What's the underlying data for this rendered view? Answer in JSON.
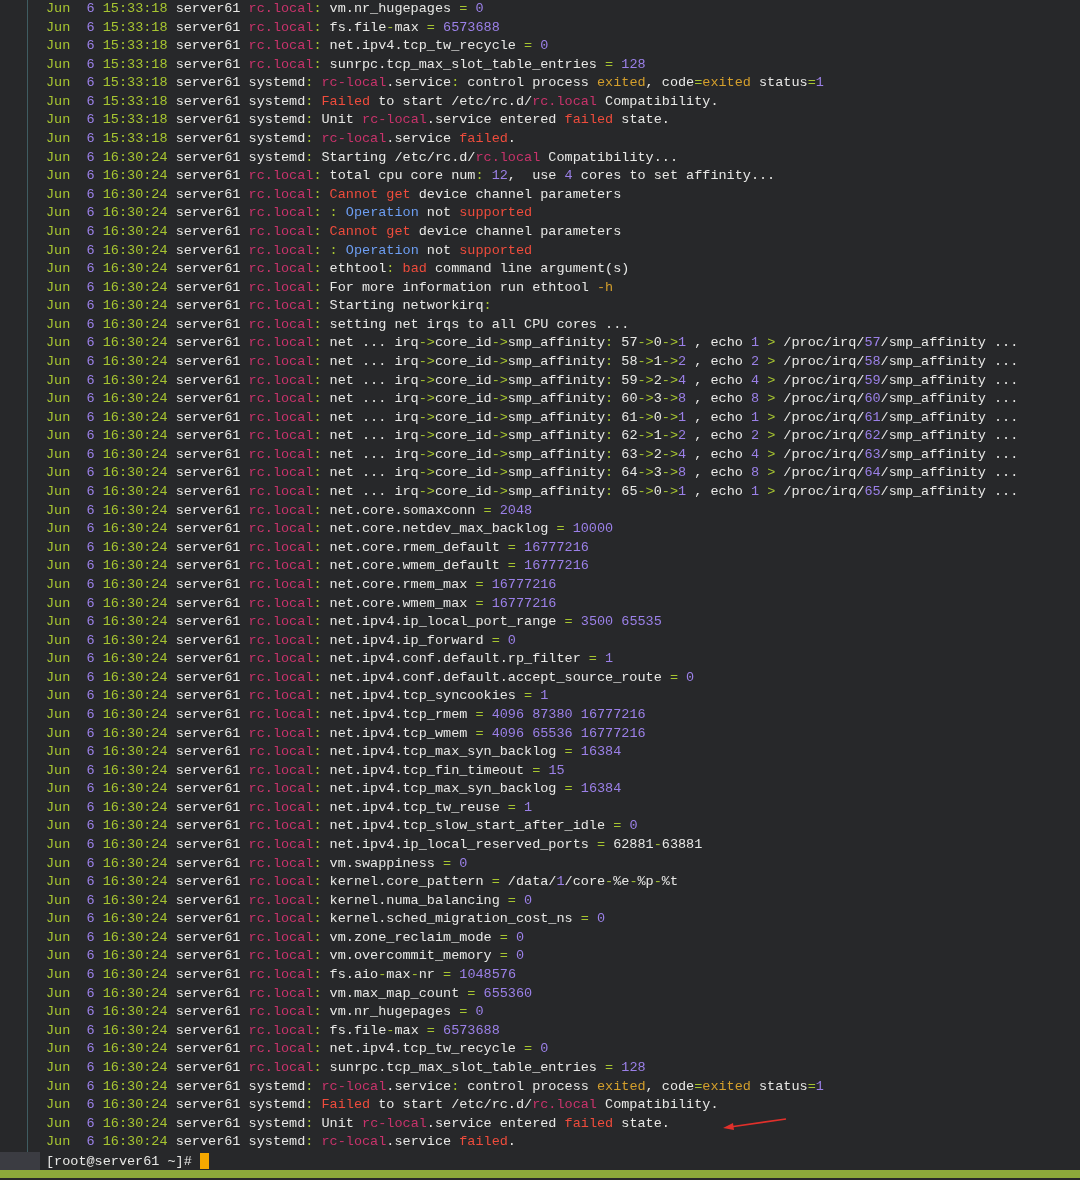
{
  "log_lines": [
    {
      "month": "Jun",
      "day": "6",
      "time": "15:33:18",
      "host": "server61",
      "process": "rc.local",
      "kind": "script",
      "message": "vm.nr_hugepages = 0"
    },
    {
      "month": "Jun",
      "day": "6",
      "time": "15:33:18",
      "host": "server61",
      "process": "rc.local",
      "kind": "script",
      "message": "fs.file-max = 6573688"
    },
    {
      "month": "Jun",
      "day": "6",
      "time": "15:33:18",
      "host": "server61",
      "process": "rc.local",
      "kind": "script",
      "message": "net.ipv4.tcp_tw_recycle = 0"
    },
    {
      "month": "Jun",
      "day": "6",
      "time": "15:33:18",
      "host": "server61",
      "process": "rc.local",
      "kind": "script",
      "message": "sunrpc.tcp_max_slot_table_entries = 128"
    },
    {
      "month": "Jun",
      "day": "6",
      "time": "15:33:18",
      "host": "server61",
      "process": "systemd",
      "kind": "daemon",
      "message": [
        {
          "text": "rc-local",
          "kind": "process"
        },
        ".service: control process ",
        {
          "text": "exited",
          "kind": "warning"
        },
        ", code=",
        {
          "text": "exited",
          "kind": "warning"
        },
        " status=1"
      ]
    },
    {
      "month": "Jun",
      "day": "6",
      "time": "15:33:18",
      "host": "server61",
      "process": "systemd",
      "kind": "daemon",
      "message": [
        {
          "text": "Failed",
          "kind": "error"
        },
        " to start /etc/rc.d/",
        {
          "text": "rc.local",
          "kind": "process"
        },
        " Compatibility."
      ]
    },
    {
      "month": "Jun",
      "day": "6",
      "time": "15:33:18",
      "host": "server61",
      "process": "systemd",
      "kind": "daemon",
      "message": [
        "Unit ",
        {
          "text": "rc-local",
          "kind": "process"
        },
        ".service entered ",
        {
          "text": "failed",
          "kind": "error"
        },
        " state."
      ]
    },
    {
      "month": "Jun",
      "day": "6",
      "time": "15:33:18",
      "host": "server61",
      "process": "systemd",
      "kind": "daemon",
      "message": [
        {
          "text": "rc-local",
          "kind": "process"
        },
        ".service ",
        {
          "text": "failed",
          "kind": "error"
        },
        "."
      ]
    },
    {
      "month": "Jun",
      "day": "6",
      "time": "16:30:24",
      "host": "server61",
      "process": "systemd",
      "kind": "daemon",
      "message": [
        "Starting /etc/rc.d/",
        {
          "text": "rc.local",
          "kind": "process"
        },
        " Compatibility..."
      ]
    },
    {
      "month": "Jun",
      "day": "6",
      "time": "16:30:24",
      "host": "server61",
      "process": "rc.local",
      "kind": "script",
      "message": "total cpu core num: 12,  use 4 cores to set affinity..."
    },
    {
      "month": "Jun",
      "day": "6",
      "time": "16:30:24",
      "host": "server61",
      "process": "rc.local",
      "kind": "script",
      "message": [
        {
          "text": "Cannot get",
          "kind": "error"
        },
        " device channel parameters"
      ]
    },
    {
      "month": "Jun",
      "day": "6",
      "time": "16:30:24",
      "host": "server61",
      "process": "rc.local",
      "kind": "script",
      "message": [
        ": ",
        {
          "text": "Operation",
          "kind": "info"
        },
        " not ",
        {
          "text": "supported",
          "kind": "error"
        }
      ]
    },
    {
      "month": "Jun",
      "day": "6",
      "time": "16:30:24",
      "host": "server61",
      "process": "rc.local",
      "kind": "script",
      "message": [
        {
          "text": "Cannot get",
          "kind": "error"
        },
        " device channel parameters"
      ]
    },
    {
      "month": "Jun",
      "day": "6",
      "time": "16:30:24",
      "host": "server61",
      "process": "rc.local",
      "kind": "script",
      "message": [
        ": ",
        {
          "text": "Operation",
          "kind": "info"
        },
        " not ",
        {
          "text": "supported",
          "kind": "error"
        }
      ]
    },
    {
      "month": "Jun",
      "day": "6",
      "time": "16:30:24",
      "host": "server61",
      "process": "rc.local",
      "kind": "script",
      "message": [
        "ethtool: ",
        {
          "text": "bad",
          "kind": "error"
        },
        " command line argument(s)"
      ]
    },
    {
      "month": "Jun",
      "day": "6",
      "time": "16:30:24",
      "host": "server61",
      "process": "rc.local",
      "kind": "script",
      "message": [
        "For more information run ethtool ",
        {
          "text": "-h",
          "kind": "warning"
        }
      ]
    },
    {
      "month": "Jun",
      "day": "6",
      "time": "16:30:24",
      "host": "server61",
      "process": "rc.local",
      "kind": "script",
      "message": "Starting networkirq:"
    },
    {
      "month": "Jun",
      "day": "6",
      "time": "16:30:24",
      "host": "server61",
      "process": "rc.local",
      "kind": "script",
      "message": "setting net irqs to all CPU cores ..."
    },
    {
      "month": "Jun",
      "day": "6",
      "time": "16:30:24",
      "host": "server61",
      "process": "rc.local",
      "kind": "script",
      "message": "net ... irq->core_id->smp_affinity: 57->0->1 , echo 1 > /proc/irq/57/smp_affinity ..."
    },
    {
      "month": "Jun",
      "day": "6",
      "time": "16:30:24",
      "host": "server61",
      "process": "rc.local",
      "kind": "script",
      "message": "net ... irq->core_id->smp_affinity: 58->1->2 , echo 2 > /proc/irq/58/smp_affinity ..."
    },
    {
      "month": "Jun",
      "day": "6",
      "time": "16:30:24",
      "host": "server61",
      "process": "rc.local",
      "kind": "script",
      "message": "net ... irq->core_id->smp_affinity: 59->2->4 , echo 4 > /proc/irq/59/smp_affinity ..."
    },
    {
      "month": "Jun",
      "day": "6",
      "time": "16:30:24",
      "host": "server61",
      "process": "rc.local",
      "kind": "script",
      "message": "net ... irq->core_id->smp_affinity: 60->3->8 , echo 8 > /proc/irq/60/smp_affinity ..."
    },
    {
      "month": "Jun",
      "day": "6",
      "time": "16:30:24",
      "host": "server61",
      "process": "rc.local",
      "kind": "script",
      "message": "net ... irq->core_id->smp_affinity: 61->0->1 , echo 1 > /proc/irq/61/smp_affinity ..."
    },
    {
      "month": "Jun",
      "day": "6",
      "time": "16:30:24",
      "host": "server61",
      "process": "rc.local",
      "kind": "script",
      "message": "net ... irq->core_id->smp_affinity: 62->1->2 , echo 2 > /proc/irq/62/smp_affinity ..."
    },
    {
      "month": "Jun",
      "day": "6",
      "time": "16:30:24",
      "host": "server61",
      "process": "rc.local",
      "kind": "script",
      "message": "net ... irq->core_id->smp_affinity: 63->2->4 , echo 4 > /proc/irq/63/smp_affinity ..."
    },
    {
      "month": "Jun",
      "day": "6",
      "time": "16:30:24",
      "host": "server61",
      "process": "rc.local",
      "kind": "script",
      "message": "net ... irq->core_id->smp_affinity: 64->3->8 , echo 8 > /proc/irq/64/smp_affinity ..."
    },
    {
      "month": "Jun",
      "day": "6",
      "time": "16:30:24",
      "host": "server61",
      "process": "rc.local",
      "kind": "script",
      "message": "net ... irq->core_id->smp_affinity: 65->0->1 , echo 1 > /proc/irq/65/smp_affinity ..."
    },
    {
      "month": "Jun",
      "day": "6",
      "time": "16:30:24",
      "host": "server61",
      "process": "rc.local",
      "kind": "script",
      "message": "net.core.somaxconn = 2048"
    },
    {
      "month": "Jun",
      "day": "6",
      "time": "16:30:24",
      "host": "server61",
      "process": "rc.local",
      "kind": "script",
      "message": "net.core.netdev_max_backlog = 10000"
    },
    {
      "month": "Jun",
      "day": "6",
      "time": "16:30:24",
      "host": "server61",
      "process": "rc.local",
      "kind": "script",
      "message": "net.core.rmem_default = 16777216"
    },
    {
      "month": "Jun",
      "day": "6",
      "time": "16:30:24",
      "host": "server61",
      "process": "rc.local",
      "kind": "script",
      "message": "net.core.wmem_default = 16777216"
    },
    {
      "month": "Jun",
      "day": "6",
      "time": "16:30:24",
      "host": "server61",
      "process": "rc.local",
      "kind": "script",
      "message": "net.core.rmem_max = 16777216"
    },
    {
      "month": "Jun",
      "day": "6",
      "time": "16:30:24",
      "host": "server61",
      "process": "rc.local",
      "kind": "script",
      "message": "net.core.wmem_max = 16777216"
    },
    {
      "month": "Jun",
      "day": "6",
      "time": "16:30:24",
      "host": "server61",
      "process": "rc.local",
      "kind": "script",
      "message": "net.ipv4.ip_local_port_range = 3500 65535"
    },
    {
      "month": "Jun",
      "day": "6",
      "time": "16:30:24",
      "host": "server61",
      "process": "rc.local",
      "kind": "script",
      "message": "net.ipv4.ip_forward = 0"
    },
    {
      "month": "Jun",
      "day": "6",
      "time": "16:30:24",
      "host": "server61",
      "process": "rc.local",
      "kind": "script",
      "message": "net.ipv4.conf.default.rp_filter = 1"
    },
    {
      "month": "Jun",
      "day": "6",
      "time": "16:30:24",
      "host": "server61",
      "process": "rc.local",
      "kind": "script",
      "message": "net.ipv4.conf.default.accept_source_route = 0"
    },
    {
      "month": "Jun",
      "day": "6",
      "time": "16:30:24",
      "host": "server61",
      "process": "rc.local",
      "kind": "script",
      "message": "net.ipv4.tcp_syncookies = 1"
    },
    {
      "month": "Jun",
      "day": "6",
      "time": "16:30:24",
      "host": "server61",
      "process": "rc.local",
      "kind": "script",
      "message": "net.ipv4.tcp_rmem = 4096 87380 16777216"
    },
    {
      "month": "Jun",
      "day": "6",
      "time": "16:30:24",
      "host": "server61",
      "process": "rc.local",
      "kind": "script",
      "message": "net.ipv4.tcp_wmem = 4096 65536 16777216"
    },
    {
      "month": "Jun",
      "day": "6",
      "time": "16:30:24",
      "host": "server61",
      "process": "rc.local",
      "kind": "script",
      "message": "net.ipv4.tcp_max_syn_backlog = 16384"
    },
    {
      "month": "Jun",
      "day": "6",
      "time": "16:30:24",
      "host": "server61",
      "process": "rc.local",
      "kind": "script",
      "message": "net.ipv4.tcp_fin_timeout = 15"
    },
    {
      "month": "Jun",
      "day": "6",
      "time": "16:30:24",
      "host": "server61",
      "process": "rc.local",
      "kind": "script",
      "message": "net.ipv4.tcp_max_syn_backlog = 16384"
    },
    {
      "month": "Jun",
      "day": "6",
      "time": "16:30:24",
      "host": "server61",
      "process": "rc.local",
      "kind": "script",
      "message": "net.ipv4.tcp_tw_reuse = 1"
    },
    {
      "month": "Jun",
      "day": "6",
      "time": "16:30:24",
      "host": "server61",
      "process": "rc.local",
      "kind": "script",
      "message": "net.ipv4.tcp_slow_start_after_idle = 0"
    },
    {
      "month": "Jun",
      "day": "6",
      "time": "16:30:24",
      "host": "server61",
      "process": "rc.local",
      "kind": "script",
      "message": "net.ipv4.ip_local_reserved_ports = 62881-63881"
    },
    {
      "month": "Jun",
      "day": "6",
      "time": "16:30:24",
      "host": "server61",
      "process": "rc.local",
      "kind": "script",
      "message": "vm.swappiness = 0"
    },
    {
      "month": "Jun",
      "day": "6",
      "time": "16:30:24",
      "host": "server61",
      "process": "rc.local",
      "kind": "script",
      "message": "kernel.core_pattern = /data/1/core-%e-%p-%t"
    },
    {
      "month": "Jun",
      "day": "6",
      "time": "16:30:24",
      "host": "server61",
      "process": "rc.local",
      "kind": "script",
      "message": "kernel.numa_balancing = 0"
    },
    {
      "month": "Jun",
      "day": "6",
      "time": "16:30:24",
      "host": "server61",
      "process": "rc.local",
      "kind": "script",
      "message": "kernel.sched_migration_cost_ns = 0"
    },
    {
      "month": "Jun",
      "day": "6",
      "time": "16:30:24",
      "host": "server61",
      "process": "rc.local",
      "kind": "script",
      "message": "vm.zone_reclaim_mode = 0"
    },
    {
      "month": "Jun",
      "day": "6",
      "time": "16:30:24",
      "host": "server61",
      "process": "rc.local",
      "kind": "script",
      "message": "vm.overcommit_memory = 0"
    },
    {
      "month": "Jun",
      "day": "6",
      "time": "16:30:24",
      "host": "server61",
      "process": "rc.local",
      "kind": "script",
      "message": "fs.aio-max-nr = 1048576"
    },
    {
      "month": "Jun",
      "day": "6",
      "time": "16:30:24",
      "host": "server61",
      "process": "rc.local",
      "kind": "script",
      "message": "vm.max_map_count = 655360"
    },
    {
      "month": "Jun",
      "day": "6",
      "time": "16:30:24",
      "host": "server61",
      "process": "rc.local",
      "kind": "script",
      "message": "vm.nr_hugepages = 0"
    },
    {
      "month": "Jun",
      "day": "6",
      "time": "16:30:24",
      "host": "server61",
      "process": "rc.local",
      "kind": "script",
      "message": "fs.file-max = 6573688"
    },
    {
      "month": "Jun",
      "day": "6",
      "time": "16:30:24",
      "host": "server61",
      "process": "rc.local",
      "kind": "script",
      "message": "net.ipv4.tcp_tw_recycle = 0"
    },
    {
      "month": "Jun",
      "day": "6",
      "time": "16:30:24",
      "host": "server61",
      "process": "rc.local",
      "kind": "script",
      "message": "sunrpc.tcp_max_slot_table_entries = 128"
    },
    {
      "month": "Jun",
      "day": "6",
      "time": "16:30:24",
      "host": "server61",
      "process": "systemd",
      "kind": "daemon",
      "message": [
        {
          "text": "rc-local",
          "kind": "process"
        },
        ".service: control process ",
        {
          "text": "exited",
          "kind": "warning"
        },
        ", code=",
        {
          "text": "exited",
          "kind": "warning"
        },
        " status=1"
      ]
    },
    {
      "month": "Jun",
      "day": "6",
      "time": "16:30:24",
      "host": "server61",
      "process": "systemd",
      "kind": "daemon",
      "message": [
        {
          "text": "Failed",
          "kind": "error"
        },
        " to start /etc/rc.d/",
        {
          "text": "rc.local",
          "kind": "process"
        },
        " Compatibility."
      ]
    },
    {
      "month": "Jun",
      "day": "6",
      "time": "16:30:24",
      "host": "server61",
      "process": "systemd",
      "kind": "daemon",
      "annotated": true,
      "message": [
        "Unit ",
        {
          "text": "rc-local",
          "kind": "process"
        },
        ".service entered ",
        {
          "text": "failed",
          "kind": "error"
        },
        " state."
      ]
    },
    {
      "month": "Jun",
      "day": "6",
      "time": "16:30:24",
      "host": "server61",
      "process": "systemd",
      "kind": "daemon",
      "message": [
        {
          "text": "rc-local",
          "kind": "process"
        },
        ".service ",
        {
          "text": "failed",
          "kind": "error"
        },
        "."
      ]
    }
  ],
  "prompt": "[root@server61 ~]#"
}
